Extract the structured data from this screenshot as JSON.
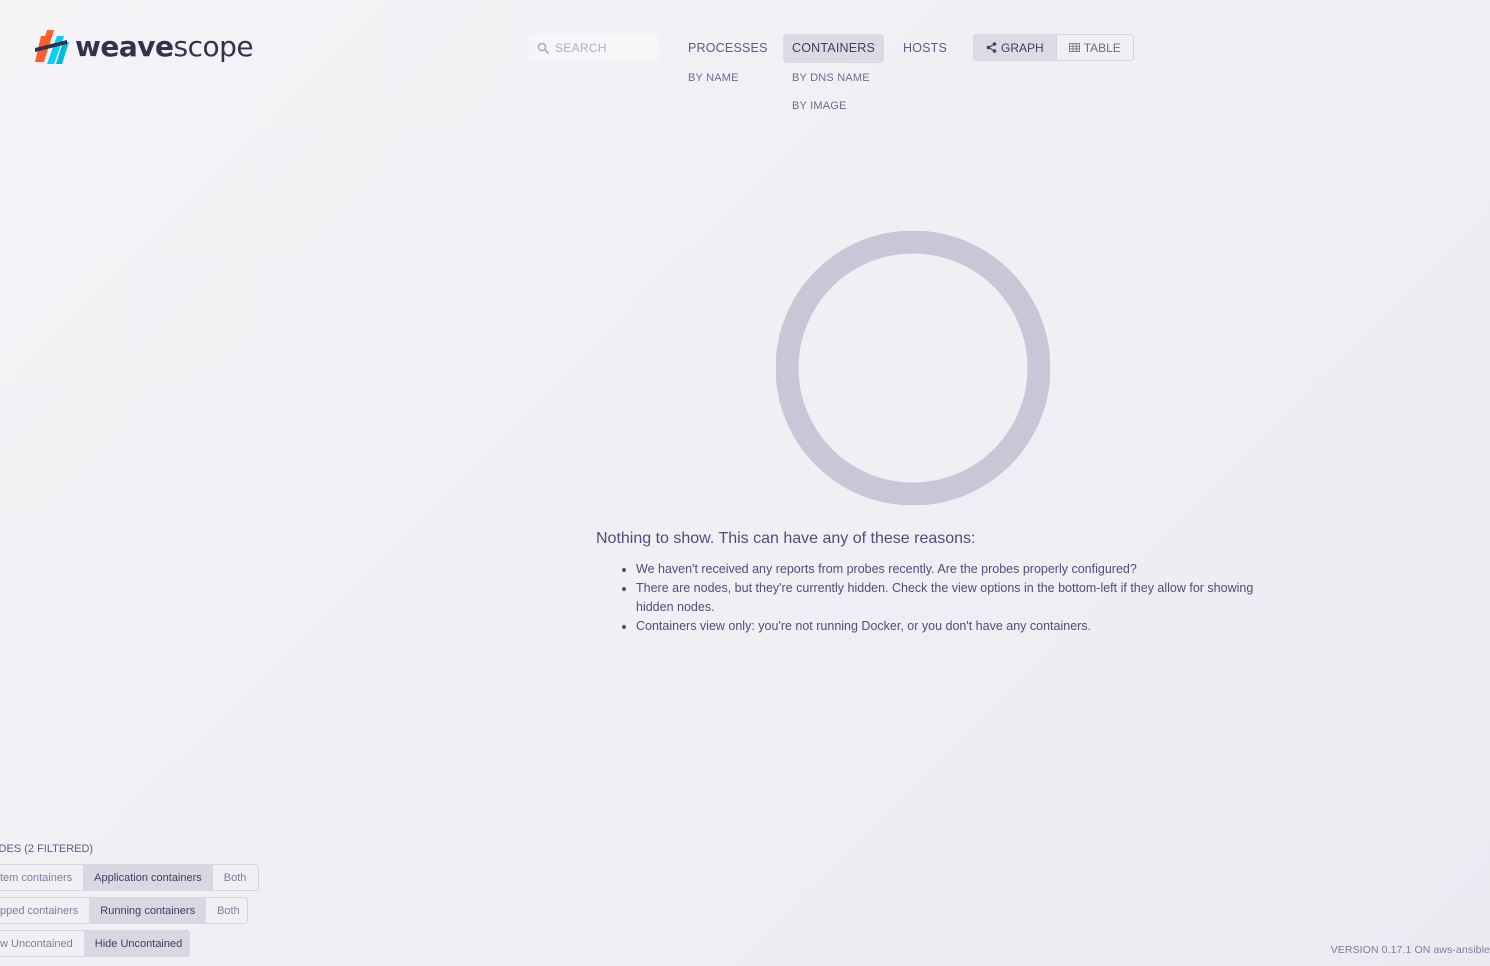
{
  "brand": {
    "name_part1": "weave",
    "name_part2": "scope"
  },
  "search": {
    "placeholder": "SEARCH"
  },
  "topologies": [
    {
      "label": "PROCESSES",
      "active": false,
      "sub": [
        "BY NAME"
      ]
    },
    {
      "label": "CONTAINERS",
      "active": true,
      "sub": [
        "BY DNS NAME",
        "BY IMAGE"
      ]
    },
    {
      "label": "HOSTS",
      "active": false,
      "sub": []
    }
  ],
  "view_mode": {
    "graph_label": "GRAPH",
    "table_label": "TABLE",
    "selected": "graph"
  },
  "empty_state": {
    "title": "Nothing to show. This can have any of these reasons:",
    "reasons": [
      "We haven't received any reports from probes recently. Are the probes properly configured?",
      "There are nodes, but they're currently hidden. Check the view options in the bottom-left if they allow for showing hidden nodes.",
      "Containers view only: you're not running Docker, or you don't have any containers."
    ]
  },
  "view_options": {
    "status": "ODES (2 FILTERED)",
    "rows": [
      {
        "options": [
          "tem containers",
          "Application containers",
          "Both"
        ],
        "selected": 1
      },
      {
        "options": [
          "pped containers",
          "Running containers",
          "Both"
        ],
        "selected": 1
      },
      {
        "options": [
          "w Uncontained",
          "Hide Uncontained"
        ],
        "selected": 1
      }
    ]
  },
  "footer": {
    "version_text": "VERSION 0.17.1 ON aws-ansible"
  },
  "colors": {
    "text": "#5b5b88",
    "active_bg": "#dcdbe5",
    "ring": "#c8c7d8",
    "logo_orange": "#ff5e2e",
    "logo_blue": "#00d2ff",
    "logo_dark": "#32324b"
  }
}
